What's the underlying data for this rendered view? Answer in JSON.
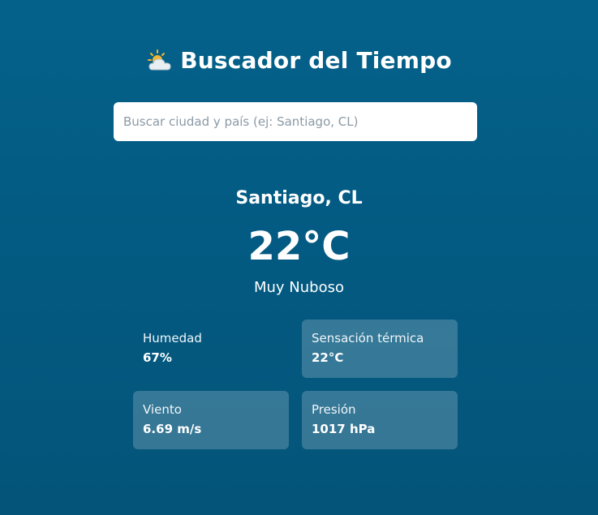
{
  "header": {
    "title": "Buscador del Tiempo",
    "icon": "sun-behind-cloud-icon"
  },
  "search": {
    "placeholder": "Buscar ciudad y país (ej: Santiago, CL)",
    "value": ""
  },
  "weather": {
    "city": "Santiago, CL",
    "temperature": "22°C",
    "description": "Muy Nuboso"
  },
  "details": [
    {
      "label": "Humedad",
      "value": "67%"
    },
    {
      "label": "Sensación térmica",
      "value": "22°C"
    },
    {
      "label": "Viento",
      "value": "6.69 m/s"
    },
    {
      "label": "Presión",
      "value": "1017 hPa"
    }
  ],
  "colors": {
    "background": "#035b83",
    "card": "#3a7b98",
    "text": "#ffffff",
    "sun": "#f5b530",
    "cloud": "#e8eef2"
  }
}
